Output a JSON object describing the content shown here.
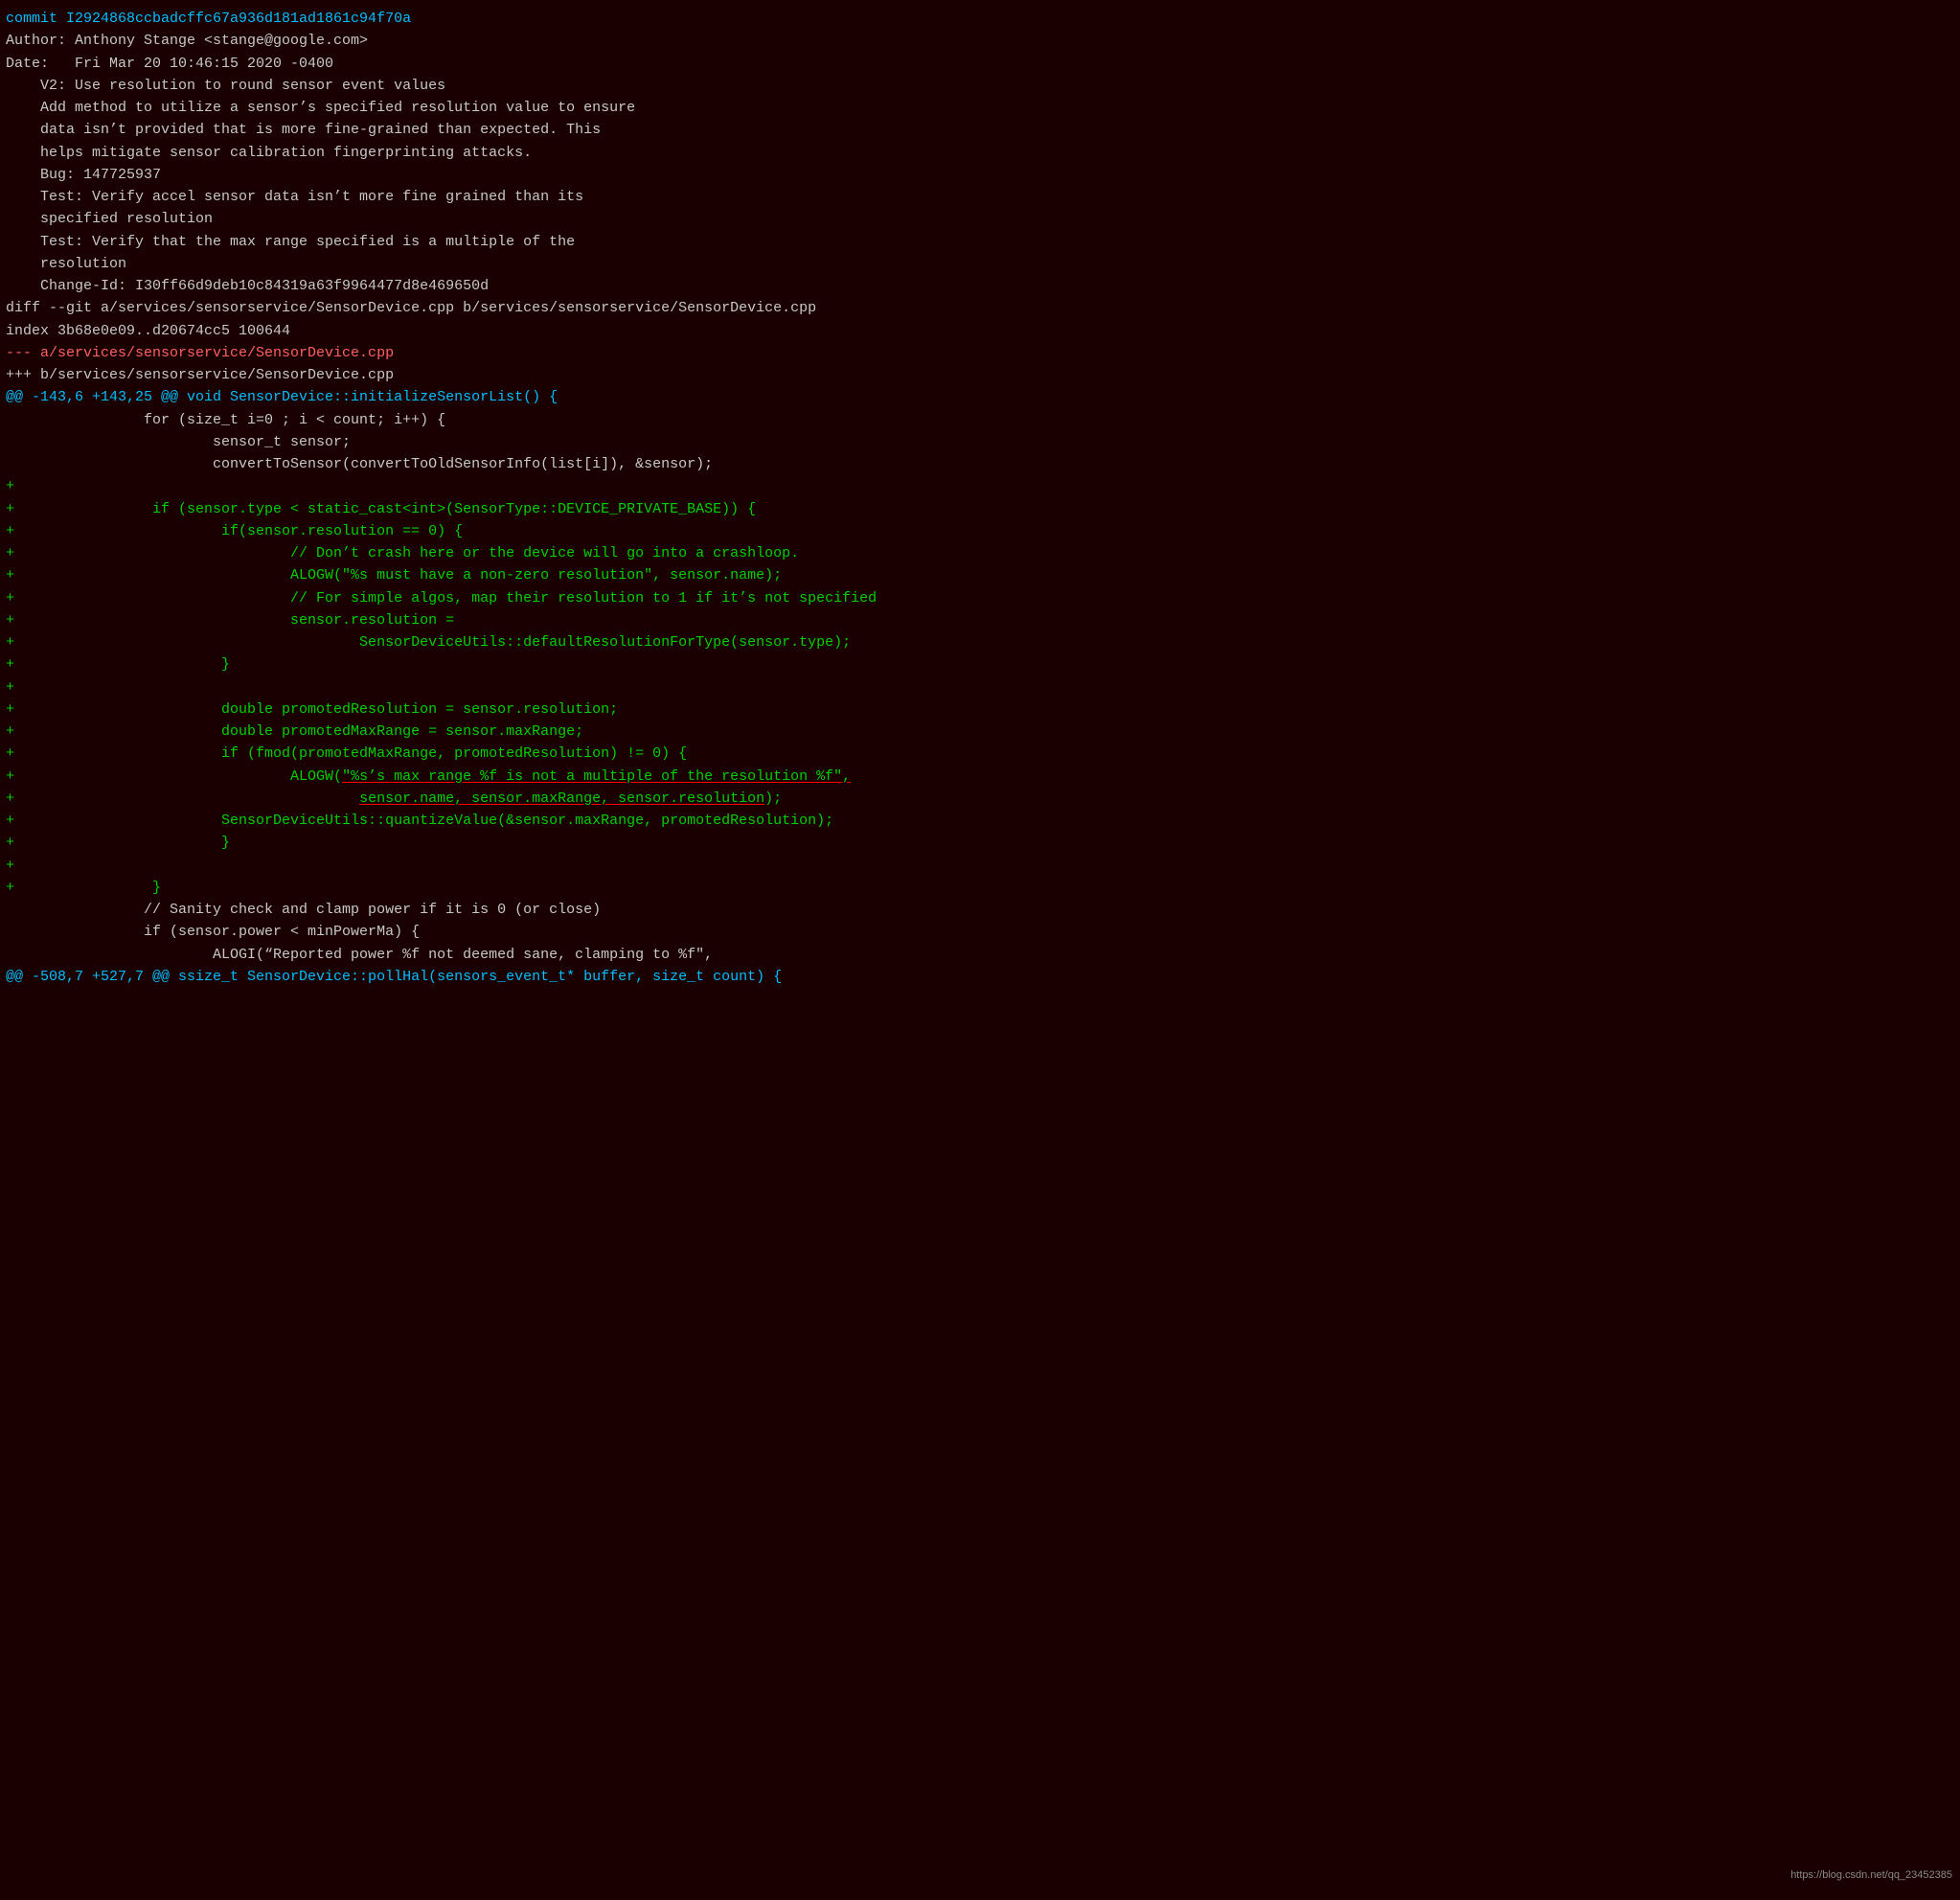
{
  "lines": [
    {
      "text": "commit I2924868ccbadcffc67a936d181ad1861c94f70a",
      "cls": "commit-hash"
    },
    {
      "text": "Author: Anthony Stange <stange@google.com>",
      "cls": "author-line"
    },
    {
      "text": "Date:   Fri Mar 20 10:46:15 2020 -0400",
      "cls": "date-line"
    },
    {
      "text": "",
      "cls": "diff-context"
    },
    {
      "text": "    V2: Use resolution to round sensor event values",
      "cls": "commit-msg"
    },
    {
      "text": "",
      "cls": "diff-context"
    },
    {
      "text": "    Add method to utilize a sensor’s specified resolution value to ensure",
      "cls": "commit-msg"
    },
    {
      "text": "    data isn’t provided that is more fine-grained than expected. This",
      "cls": "commit-msg"
    },
    {
      "text": "    helps mitigate sensor calibration fingerprinting attacks.",
      "cls": "commit-msg"
    },
    {
      "text": "",
      "cls": "diff-context"
    },
    {
      "text": "    Bug: 147725937",
      "cls": "commit-msg"
    },
    {
      "text": "    Test: Verify accel sensor data isn’t more fine grained than its",
      "cls": "commit-msg"
    },
    {
      "text": "    specified resolution",
      "cls": "commit-msg"
    },
    {
      "text": "    Test: Verify that the max range specified is a multiple of the",
      "cls": "commit-msg"
    },
    {
      "text": "    resolution",
      "cls": "commit-msg"
    },
    {
      "text": "",
      "cls": "diff-context"
    },
    {
      "text": "    Change-Id: I30ff66d9deb10c84319a63f9964477d8e469650d",
      "cls": "commit-msg"
    },
    {
      "text": "",
      "cls": "diff-context"
    },
    {
      "text": "diff --git a/services/sensorservice/SensorDevice.cpp b/services/sensorservice/SensorDevice.cpp",
      "cls": "diff-header"
    },
    {
      "text": "index 3b68e0e09..d20674cc5 100644",
      "cls": "diff-meta"
    },
    {
      "text": "--- a/services/sensorservice/SensorDevice.cpp",
      "cls": "diff-minus-file"
    },
    {
      "text": "+++ b/services/sensorservice/SensorDevice.cpp",
      "cls": "diff-plus-file"
    },
    {
      "text": "@@ -143,6 +143,25 @@ void SensorDevice::initializeSensorList() {",
      "cls": "diff-chunk"
    },
    {
      "text": "                for (size_t i=0 ; i < count; i++) {",
      "cls": "diff-context"
    },
    {
      "text": "                        sensor_t sensor;",
      "cls": "diff-context"
    },
    {
      "text": "                        convertToSensor(convertToOldSensorInfo(list[i]), &sensor);",
      "cls": "diff-context"
    },
    {
      "text": "+",
      "cls": "diff-added"
    },
    {
      "text": "+                if (sensor.type < static_cast<int>(SensorType::DEVICE_PRIVATE_BASE)) {",
      "cls": "diff-added"
    },
    {
      "text": "+                        if(sensor.resolution == 0) {",
      "cls": "diff-added"
    },
    {
      "text": "+                                // Don’t crash here or the device will go into a crashloop.",
      "cls": "diff-added"
    },
    {
      "text": "+                                ALOGW(\"%s must have a non-zero resolution\", sensor.name);",
      "cls": "diff-added"
    },
    {
      "text": "+                                // For simple algos, map their resolution to 1 if it’s not specified",
      "cls": "diff-added"
    },
    {
      "text": "+                                sensor.resolution =",
      "cls": "diff-added"
    },
    {
      "text": "+                                        SensorDeviceUtils::defaultResolutionForType(sensor.type);",
      "cls": "diff-added"
    },
    {
      "text": "+                        }",
      "cls": "diff-added"
    },
    {
      "text": "+",
      "cls": "diff-added"
    },
    {
      "text": "+                        double promotedResolution = sensor.resolution;",
      "cls": "diff-added"
    },
    {
      "text": "+                        double promotedMaxRange = sensor.maxRange;",
      "cls": "diff-added"
    },
    {
      "text": "+                        if (fmod(promotedMaxRange, promotedResolution) != 0) {",
      "cls": "diff-added"
    },
    {
      "text": "+                                ALOGW(\"%s’s max range %f is not a multiple of the resolution %f\",",
      "cls": "diff-added-underline"
    },
    {
      "text": "+                                        sensor.name, sensor.maxRange, sensor.resolution);",
      "cls": "diff-added-underline2"
    },
    {
      "text": "+                        SensorDeviceUtils::quantizeValue(&sensor.maxRange, promotedResolution);",
      "cls": "diff-added"
    },
    {
      "text": "+                        }",
      "cls": "diff-added"
    },
    {
      "text": "+",
      "cls": "diff-added"
    },
    {
      "text": "+                }",
      "cls": "diff-added"
    },
    {
      "text": "                // Sanity check and clamp power if it is 0 (or close)",
      "cls": "diff-context"
    },
    {
      "text": "                if (sensor.power < minPowerMa) {",
      "cls": "diff-context"
    },
    {
      "text": "                        ALOGI(“Reported power %f not deemed sane, clamping to %f\",",
      "cls": "diff-context"
    },
    {
      "text": "@@ -508,7 +527,7 @@ ssize_t SensorDevice::pollHal(sensors_event_t* buffer, size_t count) {",
      "cls": "diff-chunk"
    }
  ],
  "watermark": "https://blog.csdn.net/qq_23452385"
}
